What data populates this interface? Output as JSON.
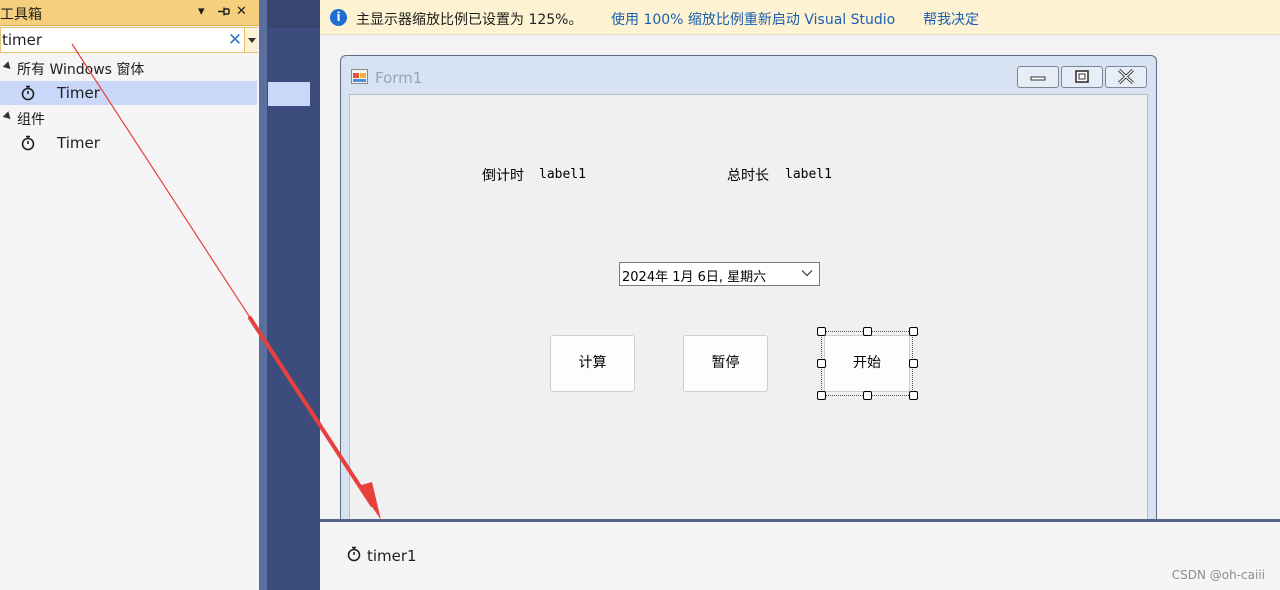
{
  "toolbox": {
    "title": "工具箱",
    "header_icons": {
      "dropdown": "▾",
      "pin": "⊣",
      "close": "✕"
    },
    "search": {
      "value": "timer",
      "clear_icon": "✕"
    },
    "categories": [
      {
        "label": "所有 Windows 窗体",
        "items": [
          {
            "label": "Timer",
            "icon": "stopwatch-icon",
            "selected": true
          }
        ]
      },
      {
        "label": "组件",
        "items": [
          {
            "label": "Timer",
            "icon": "stopwatch-icon",
            "selected": false
          }
        ]
      }
    ]
  },
  "infobar": {
    "icon": "i",
    "message": "主显示器缩放比例已设置为 125%。",
    "link_restart": "使用 100% 缩放比例重新启动 Visual Studio",
    "link_decide": "帮我决定"
  },
  "form": {
    "title": "Form1",
    "label_countdown": "倒计时",
    "label_countdown_value": "label1",
    "label_total": "总时长",
    "label_total_value": "label1",
    "datepicker_value": "2024年 1月  6日, 星期六",
    "datepicker_chevron": "⌵",
    "buttons": {
      "calculate": "计算",
      "pause": "暂停",
      "start": "开始"
    }
  },
  "tray": {
    "component": "timer1",
    "icon": "stopwatch-icon"
  },
  "watermark": "CSDN @oh-caiii",
  "colors": {
    "toolbox_header": "#f5cf7c",
    "selected_item": "#c9d8f8",
    "infobar_bg": "#fdf3d3",
    "link": "#1c5fb0",
    "arrow": "#e8403c",
    "dark_panel": "#3c4c7c"
  }
}
